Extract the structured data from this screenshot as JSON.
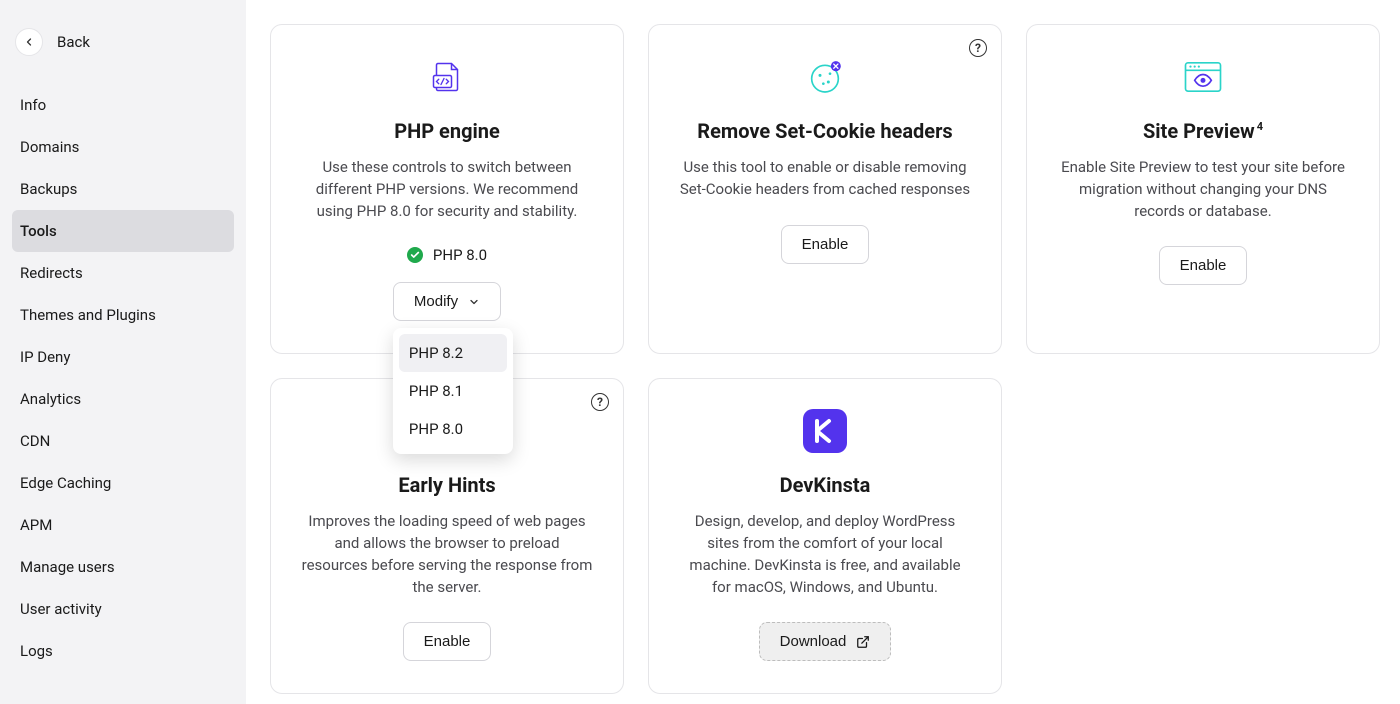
{
  "sidebar": {
    "back_label": "Back",
    "items": [
      {
        "label": "Info",
        "active": false
      },
      {
        "label": "Domains",
        "active": false
      },
      {
        "label": "Backups",
        "active": false
      },
      {
        "label": "Tools",
        "active": true
      },
      {
        "label": "Redirects",
        "active": false
      },
      {
        "label": "Themes and Plugins",
        "active": false
      },
      {
        "label": "IP Deny",
        "active": false
      },
      {
        "label": "Analytics",
        "active": false
      },
      {
        "label": "CDN",
        "active": false
      },
      {
        "label": "Edge Caching",
        "active": false
      },
      {
        "label": "APM",
        "active": false
      },
      {
        "label": "Manage users",
        "active": false
      },
      {
        "label": "User activity",
        "active": false
      },
      {
        "label": "Logs",
        "active": false
      }
    ]
  },
  "cards": {
    "php_engine": {
      "title": "PHP engine",
      "desc": "Use these controls to switch between different PHP versions. We recommend using PHP 8.0 for security and stability.",
      "status_label": "PHP 8.0",
      "modify_label": "Modify",
      "dropdown": [
        "PHP 8.2",
        "PHP 8.1",
        "PHP 8.0"
      ],
      "dropdown_highlight": 0
    },
    "remove_cookie": {
      "title": "Remove Set-Cookie headers",
      "desc": "Use this tool to enable or disable removing Set-Cookie headers from cached responses",
      "button_label": "Enable"
    },
    "site_preview": {
      "title": "Site Preview",
      "footnote": "4",
      "desc": "Enable Site Preview to test your site before migration without changing your DNS records or database.",
      "button_label": "Enable"
    },
    "early_hints": {
      "title": "Early Hints",
      "desc": "Improves the loading speed of web pages and allows the browser to preload resources before serving the response from the server.",
      "button_label": "Enable"
    },
    "devkinsta": {
      "title": "DevKinsta",
      "desc": "Design, develop, and deploy WordPress sites from the comfort of your local machine. DevKinsta is free, and available for macOS, Windows, and Ubuntu.",
      "button_label": "Download"
    }
  },
  "colors": {
    "accent_purple": "#5333ed",
    "accent_teal": "#2ad4c9",
    "success_green": "#1fa94c"
  }
}
